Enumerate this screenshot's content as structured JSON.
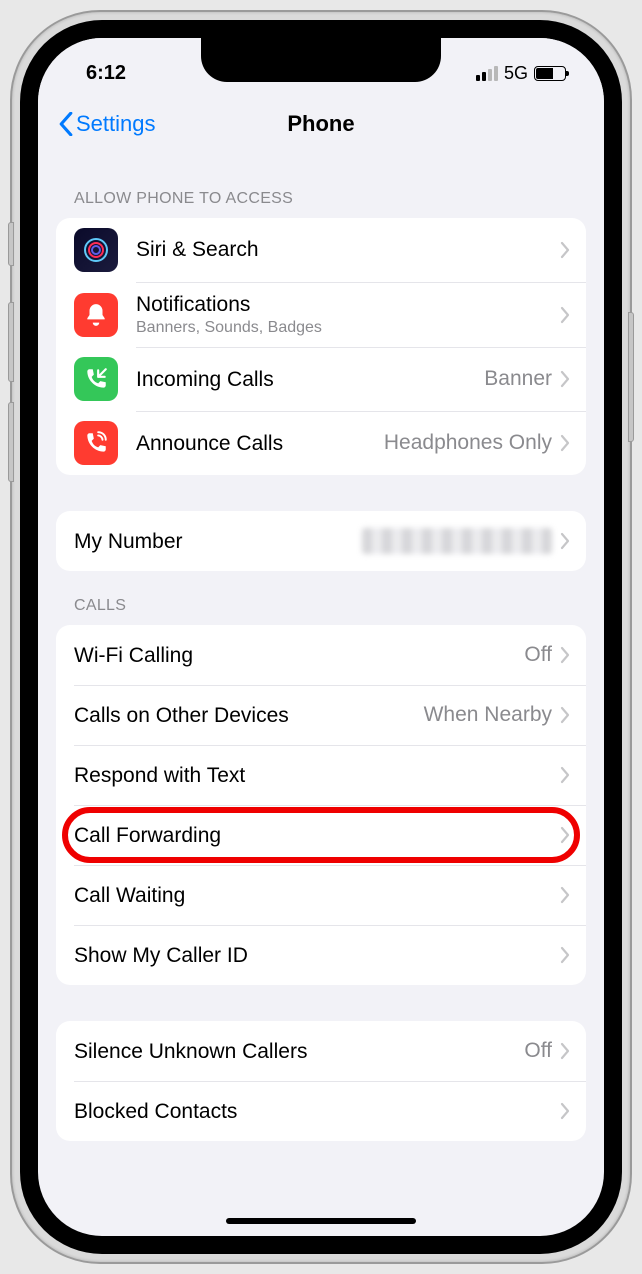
{
  "status": {
    "time": "6:12",
    "network": "5G"
  },
  "nav": {
    "back": "Settings",
    "title": "Phone"
  },
  "sections": {
    "access": {
      "header": "ALLOW PHONE TO ACCESS",
      "siri": "Siri & Search",
      "notifications_title": "Notifications",
      "notifications_sub": "Banners, Sounds, Badges",
      "incoming_title": "Incoming Calls",
      "incoming_value": "Banner",
      "announce_title": "Announce Calls",
      "announce_value": "Headphones Only"
    },
    "mynumber": {
      "title": "My Number"
    },
    "calls": {
      "header": "CALLS",
      "wifi_title": "Wi-Fi Calling",
      "wifi_value": "Off",
      "other_title": "Calls on Other Devices",
      "other_value": "When Nearby",
      "respond": "Respond with Text",
      "forwarding": "Call Forwarding",
      "waiting": "Call Waiting",
      "callerid": "Show My Caller ID"
    },
    "extras": {
      "silence_title": "Silence Unknown Callers",
      "silence_value": "Off",
      "blocked": "Blocked Contacts"
    }
  }
}
